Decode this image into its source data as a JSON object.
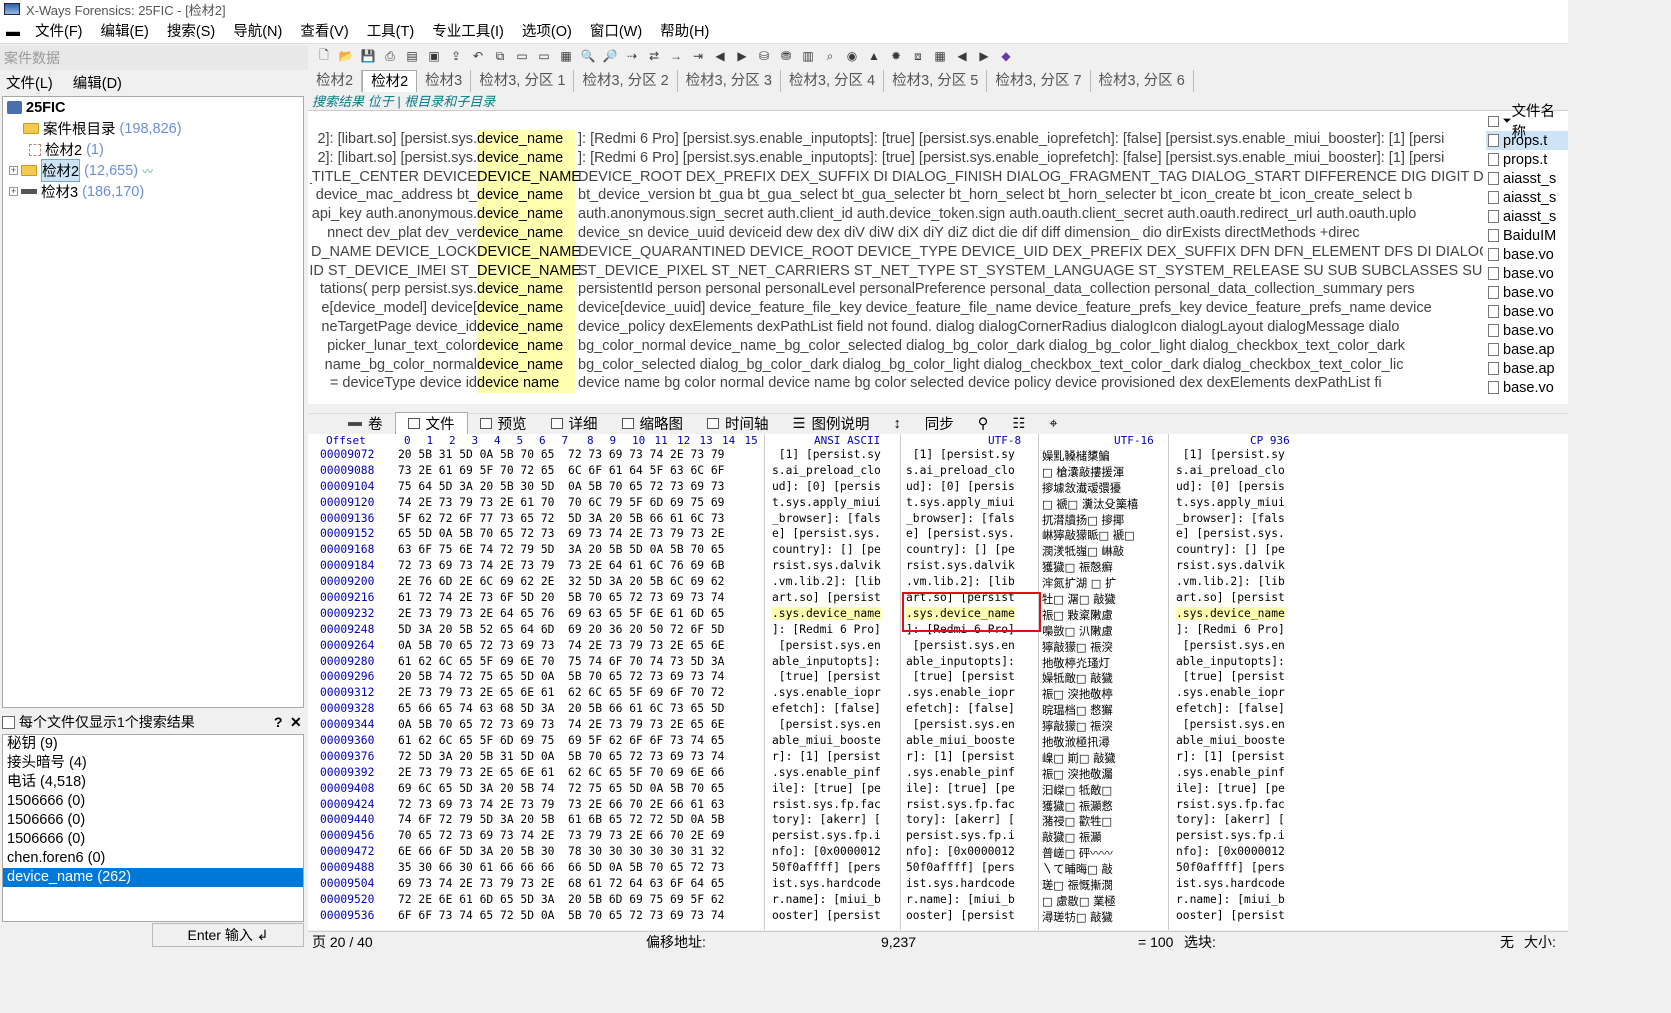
{
  "window": {
    "title": "X-Ways Forensics: 25FIC - [检材2]"
  },
  "menu": [
    "文件(F)",
    "编辑(E)",
    "搜索(S)",
    "导航(N)",
    "查看(V)",
    "工具(T)",
    "专业工具(I)",
    "选项(O)",
    "窗口(W)",
    "帮助(H)"
  ],
  "case_panel": {
    "title": "案件数据",
    "menu": [
      "文件(L)",
      "编辑(D)"
    ],
    "tree": [
      {
        "label": "25FIC",
        "count": ""
      },
      {
        "label": "案件根目录",
        "count": "(198,826)"
      },
      {
        "label": "检材2",
        "count": "(1)"
      },
      {
        "label": "检材2",
        "count": "(12,655)"
      },
      {
        "label": "检材3",
        "count": "(186,170)"
      }
    ],
    "option": "每个文件仅显示1个搜索结果",
    "terms": [
      "秘钥 (9)",
      "接头暗号 (4)",
      "电话 (4,518)",
      "1506666 (0)",
      "1506666 (0)",
      "1506666 (0)",
      "chen.foren6 (0)",
      "device_name (262)"
    ],
    "enter_label": "Enter 输入 ↲"
  },
  "tabs": [
    "检材2",
    "检材2",
    "检材3",
    "检材3, 分区 1",
    "检材3, 分区 2",
    "检材3, 分区 3",
    "检材3, 分区 4",
    "检材3, 分区 5",
    "检材3, 分区 7",
    "检材3, 分区 6"
  ],
  "search_location": "搜索结果 位于 | 根目录和子目录",
  "results": [
    {
      "pre": "2]: [libart.so] [persist.sys.",
      "hit": "device_name",
      "post": "]: [Redmi 6 Pro] [persist.sys.enable_inputopts]: [true] [persist.sys.enable_ioprefetch]: [false] [persist.sys.enable_miui_booster]: [1] [persi"
    },
    {
      "pre": "2]: [libart.so] [persist.sys.",
      "hit": "device_name",
      "post": "]: [Redmi 6 Pro] [persist.sys.enable_inputopts]: [true] [persist.sys.enable_ioprefetch]: [false] [persist.sys.enable_miui_booster]: [1] [persi"
    },
    {
      "pre": "_TITLE_CENTER DEVICE ",
      "hit": "DEVICE_NAME",
      "post": "DEVICE_ROOT DEX_PREFIX DEX_SUFFIX DI DIALOG_FINISH DIALOG_FRAGMENT_TAG DIALOG_START DIFFERENCE DIG DIGIT DIGI"
    },
    {
      "pre": "device_mac_address bt_",
      "hit": "device_name",
      "post": "bt_device_version bt_gua bt_gua_select bt_gua_selecter bt_horn_select bt_horn_selecter bt_icon_create bt_icon_create_select b"
    },
    {
      "pre": "api_key auth.anonymous.",
      "hit": "device_name",
      "post": "auth.anonymous.sign_secret auth.client_id auth.device_token.sign auth.oauth.client_secret auth.oauth.redirect_url auth.oauth.uplo"
    },
    {
      "pre": "nnect dev_plat dev_ver ",
      "hit": "device_name",
      "post": "device_sn device_uuid deviceid dew dex diV diW diX diY diZ dict die dif diff dimension_ dio dirExists directMethods +direc"
    },
    {
      "pre": "D_NAME DEVICE_LOCK ",
      "hit": "DEVICE_NAME",
      "post": "DEVICE_QUARANTINED DEVICE_ROOT DEVICE_TYPE DEVICE_UID DEX_PREFIX DEX_SUFFIX DFN DFN_ELEMENT DFS DI DIALOG_AL"
    },
    {
      "pre": "_ID ST_DEVICE_IMEI ST_",
      "hit": "DEVICE_NAME",
      "post": "ST_DEVICE_PIXEL ST_NET_CARRIERS ST_NET_TYPE ST_SYSTEM_LANGUAGE ST_SYSTEM_RELEASE SU SUB SUBCLASSES SUBJECT S"
    },
    {
      "pre": "tations( perp persist.sys.",
      "hit": "device_name",
      "post": "persistentId person personal personalLevel personalPreference personal_data_collection personal_data_collection_summary pers"
    },
    {
      "pre": "e[device_model] device[",
      "hit": "device_name",
      "post": "device[device_uuid] device_feature_file_key device_feature_file_name device_feature_prefs_key device_feature_prefs_name device"
    },
    {
      "pre": "neTargetPage device_id ",
      "hit": "device_name",
      "post": "device_policy dexElements dexPathList field not found. dialog dialogCornerRadius dialogIcon dialogLayout dialogMessage dialo"
    },
    {
      "pre": "picker_lunar_text_color ",
      "hit": "device_name",
      "post": "bg_color_normal device_name_bg_color_selected dialog_bg_color_dark dialog_bg_color_light dialog_checkbox_text_color_dark"
    },
    {
      "pre": "name_bg_color_normal ",
      "hit": "device_name",
      "post": "bg_color_selected dialog_bg_color_dark dialog_bg_color_light dialog_checkbox_text_color_dark dialog_checkbox_text_color_lic"
    },
    {
      "pre": "= deviceType device id ",
      "hit": "device name",
      "post": "device name bg color normal device name bg color selected device policy device provisioned dex dexElements dexPathList fi"
    }
  ],
  "files": {
    "header": "文件名称",
    "items": [
      "props.t",
      "props.t",
      "aiasst_s",
      "aiasst_s",
      "aiasst_s",
      "BaiduIM",
      "base.vo",
      "base.vo",
      "base.vo",
      "base.vo",
      "base.vo",
      "base.ap",
      "base.ap",
      "base.vo"
    ]
  },
  "viewbar": [
    "卷",
    "文件",
    "预览",
    "详细",
    "缩略图",
    "时间轴",
    "图例说明",
    "同步"
  ],
  "hex": {
    "head": {
      "offset": "Offset",
      "cols": [
        "0",
        "1",
        "2",
        "3",
        "4",
        "5",
        "6",
        "7",
        "8",
        "9",
        "10",
        "11",
        "12",
        "13",
        "14",
        "15"
      ],
      "ansi": "ANSI ASCII",
      "utf8": "UTF-8",
      "utf16": "UTF-16",
      "cp": "CP 936"
    },
    "rows": [
      {
        "o": "00009072",
        "h": "20 5B 31 5D 0A 5B 70 65  72 73 69 73 74 2E 73 79",
        "a": " [1] [persist.sy",
        "u": " [1] [persist.sy",
        "w": "嬠䵝ۘ䡦槠橥鳊",
        "c": " [1] [persist.sy"
      },
      {
        "o": "00009088",
        "h": "73 2E 61 69 5F 70 72 65  6C 6F 61 64 5F 63 6C 6F",
        "a": "s.ai_preload_clo",
        "u": "s.ai_preload_clo",
        "w": "□ 槍灢敲摟援渾",
        "c": "s.ai_preload_clo"
      },
      {
        "o": "00009104",
        "h": "75 64 5D 3A 20 5B 30 5D  0A 5B 70 65 72 73 69 73",
        "a": "ud]: [0] [persis",
        "u": "ud]: [0] [persis",
        "w": "摉壉敜瀐叆彋獶",
        "c": "ud]: [0] [persis"
      },
      {
        "o": "00009120",
        "h": "74 2E 73 79 73 2E 61 70  70 6C 79 5F 6D 69 75 69",
        "a": "t.sys.apply_miui",
        "u": "t.sys.apply_miui",
        "w": "□ 褫□ 瀵汰殳篥橲",
        "c": "t.sys.apply_miui"
      },
      {
        "o": "00009136",
        "h": "5F 62 72 6F 77 73 65 72  5D 3A 20 5B 66 61 6C 73",
        "a": "_browser]: [fals",
        "u": "_browser]: [fals",
        "w": "扤潸牘扬□ 摉揶",
        "c": "_browser]: [fals"
      },
      {
        "o": "00009152",
        "h": "65 5D 0A 5B 70 65 72 73  69 73 74 2E 73 79 73 2E",
        "a": "e] [persist.sys.",
        "u": "e] [persist.sys.",
        "w": "崊獰敲獴眽□ 褫□",
        "c": "e] [persist.sys."
      },
      {
        "o": "00009168",
        "h": "63 6F 75 6E 74 72 79 5D  3A 20 5B 5D 0A 5B 70 65",
        "a": "country]: [] [pe",
        "u": "country]: [] [pe",
        "w": "潣湵牴嵹□ 崊敲",
        "c": "country]: [] [pe"
      },
      {
        "o": "00009184",
        "h": "72 73 69 73 74 2E 73 79  73 2E 64 61 6C 76 69 6B",
        "a": "rsist.sys.dalvik",
        "u": "rsist.sys.dalvik",
        "w": "獲獩□ 祳慤癬",
        "c": "rsist.sys.dalvik"
      },
      {
        "o": "00009200",
        "h": "2E 76 6D 2E 6C 69 62 2E  32 5D 3A 20 5B 6C 69 62",
        "a": ".vm.lib.2]: [lib",
        ".vm.lib.2]: [lib": "",
        "u": ".vm.lib.2]: [lib",
        "w": "浶氮扩湖 □ 扩",
        "c": ".vm.lib.2]: [lib"
      },
      {
        "o": "00009216",
        "h": "61 72 74 2E 73 6F 5D 20  5B 70 65 72 73 69 73 74",
        "a": "art.so] [persist",
        "u": "art.so] [persist",
        "w": "牡□ 潳□ 敲獩",
        "c": "art.so] [persist"
      },
      {
        "o": "00009232",
        "h": "2E 73 79 73 2E 64 65 76  69 63 65 5F 6E 61 6D 65",
        "a": ".sys.device_name",
        "u": ".sys.device_name",
        "w": "祳□ 敤楶敶慮",
        "c": ".sys.device_name"
      },
      {
        "o": "00009248",
        "h": "5D 3A 20 5B 52 65 64 6D  69 20 36 20 50 72 6F 5D",
        "a": "]: [Redmi 6 Pro]",
        "u": "]: [Redmi 6 Pro]",
        "w": "嘄敳□ 汃敶慮",
        "c": "]: [Redmi 6 Pro]"
      },
      {
        "o": "00009264",
        "h": "0A 5B 70 65 72 73 69 73  74 2E 73 79 73 2E 65 6E",
        "a": " [persist.sys.en",
        " [persist.sys.en": "",
        "u": " [persist.sys.en",
        "w": "獰敲獴□ 祳湥",
        "c": " [persist.sys.en"
      },
      {
        "o": "00009280",
        "h": "61 62 6C 65 5F 69 6E 70  75 74 6F 70 74 73 5D 3A",
        "a": "able_inputopts]:",
        "u": "able_inputopts]:",
        "w": "扡敬楟灮瑵灯",
        "c": "able_inputopts]:"
      },
      {
        "o": "00009296",
        "h": "20 5B 74 72 75 65 5D 0A  5B 70 65 72 73 69 73 74",
        "a": " [true] [persist",
        "u": " [true] [persist",
        "w": "嬠牴敵□ 敲獩",
        "c": " [true] [persist"
      },
      {
        "o": "00009312",
        "h": "2E 73 79 73 2E 65 6E 61  62 6C 65 5F 69 6F 70 72",
        "a": ".sys.enable_iopr",
        "u": ".sys.enable_iopr",
        "w": "祳□ 湥扡敬楟",
        "c": ".sys.enable_iopr"
      },
      {
        "o": "00009328",
        "h": "65 66 65 74 63 68 5D 3A  20 5B 66 61 6C 73 65 5D",
        "a": "efetch]: [false]",
        "u": "efetch]: [false]",
        "w": "晥瑥档□ 慦獬",
        "c": "efetch]: [false]"
      },
      {
        "o": "00009344",
        "h": "0A 5B 70 65 72 73 69 73  74 2E 73 79 73 2E 65 6E",
        "a": " [persist.sys.en",
        "u": " [persist.sys.en",
        "w": "獰敲獴□ 祳湥",
        "c": " [persist.sys.en"
      },
      {
        "o": "00009360",
        "h": "61 62 6C 65 5F 6D 69 75  69 5F 62 6F 6F 73 74 65",
        "a": "able_miui_booste",
        "u": "able_miui_booste",
        "w": "扡敬浟極扟潯",
        "c": "able_miui_booste"
      },
      {
        "o": "00009376",
        "h": "72 5D 3A 20 5B 31 5D 0A  5B 70 65 72 73 69 73 74",
        "a": "r]: [1] [persist",
        "u": "r]: [1] [persist",
        "w": "嵲□ 崱□ 敲獩",
        "c": "r]: [1] [persist"
      },
      {
        "o": "00009392",
        "h": "2E 73 79 73 2E 65 6E 61  62 6C 65 5F 70 69 6E 66",
        "a": ".sys.enable_pinf",
        "u": ".sys.enable_pinf",
        "w": "祳□ 湥扡敬灟",
        "c": ".sys.enable_pinf"
      },
      {
        "o": "00009408",
        "h": "69 6C 65 5D 3A 20 5B 74  72 75 65 5D 0A 5B 70 65",
        "a": "ile]: [true] [pe",
        "u": "ile]: [true] [pe",
        "w": "汩嵥□ 牴敵□",
        "c": "ile]: [true] [pe"
      },
      {
        "o": "00009424",
        "h": "72 73 69 73 74 2E 73 79  73 2E 66 70 2E 66 61 63",
        "a": "rsist.sys.fp.fac",
        "u": "rsist.sys.fp.fac",
        "w": "獲獩□ 祳灦慦",
        "c": "rsist.sys.fp.fac"
      },
      {
        "o": "00009440",
        "h": "74 6F 72 79 5D 3A 20 5B  61 6B 65 72 72 5D 0A 5B",
        "a": "tory]: [akerr] [",
        "u": "tory]: [akerr] [",
        "w": "潴祲□ 歡牲□",
        "c": "tory]: [akerr] ["
      },
      {
        "o": "00009456",
        "h": "70 65 72 73 69 73 74 2E  73 79 73 2E 66 70 2E 69",
        "a": "persist.sys.fp.i",
        "u": "persist.sys.fp.i",
        "w": "敲獩□ 祳灦",
        "c": "persist.sys.fp.i"
      },
      {
        "o": "00009472",
        "h": "6E 66 6F 5D 3A 20 5B 30  78 30 30 30 30 30 31 32",
        "a": "nfo]: [0x0000012",
        "u": "nfo]: [0x0000012",
        "w": "普嵯□ 砰〰〰",
        "c": "nfo]: [0x0000012"
      },
      {
        "o": "00009488",
        "h": "35 30 66 30 61 66 66 66  66 5D 0A 5B 70 65 72 73",
        "a": "50f0affff] [pers",
        "u": "50f0affff] [pers",
        "w": "〵て晡晦□ 敲",
        "c": "50f0affff] [pers"
      },
      {
        "o": "00009504",
        "h": "69 73 74 2E 73 79 73 2E  68 61 72 64 63 6F 64 65",
        "a": "ist.sys.hardcode",
        "u": "ist.sys.hardcode",
        "w": "瑳□ 祳慨摲潣",
        "c": "ist.sys.hardcode"
      },
      {
        "o": "00009520",
        "h": "72 2E 6E 61 6D 65 5D 3A  20 5B 6D 69 75 69 5F 62",
        "a": "r.name]: [miui_b",
        "u": "r.name]: [miui_b",
        "w": "□ 慮敭□ 業極",
        "c": "r.name]: [miui_b"
      },
      {
        "o": "00009536",
        "h": "6F 6F 73 74 65 72 5D 0A  5B 70 65 72 73 69 73 74",
        "a": "ooster] [persist",
        "u": "ooster] [persist",
        "w": "潯瑳牥□ 敲獩",
        "c": "ooster] [persist"
      }
    ]
  },
  "status": {
    "page": "页 20 / 40",
    "offset_label": "偏移地址:",
    "offset_value": "9,237",
    "eq": "= 100",
    "sel": "选块:",
    "none": "无",
    "size_label": "大小:"
  }
}
